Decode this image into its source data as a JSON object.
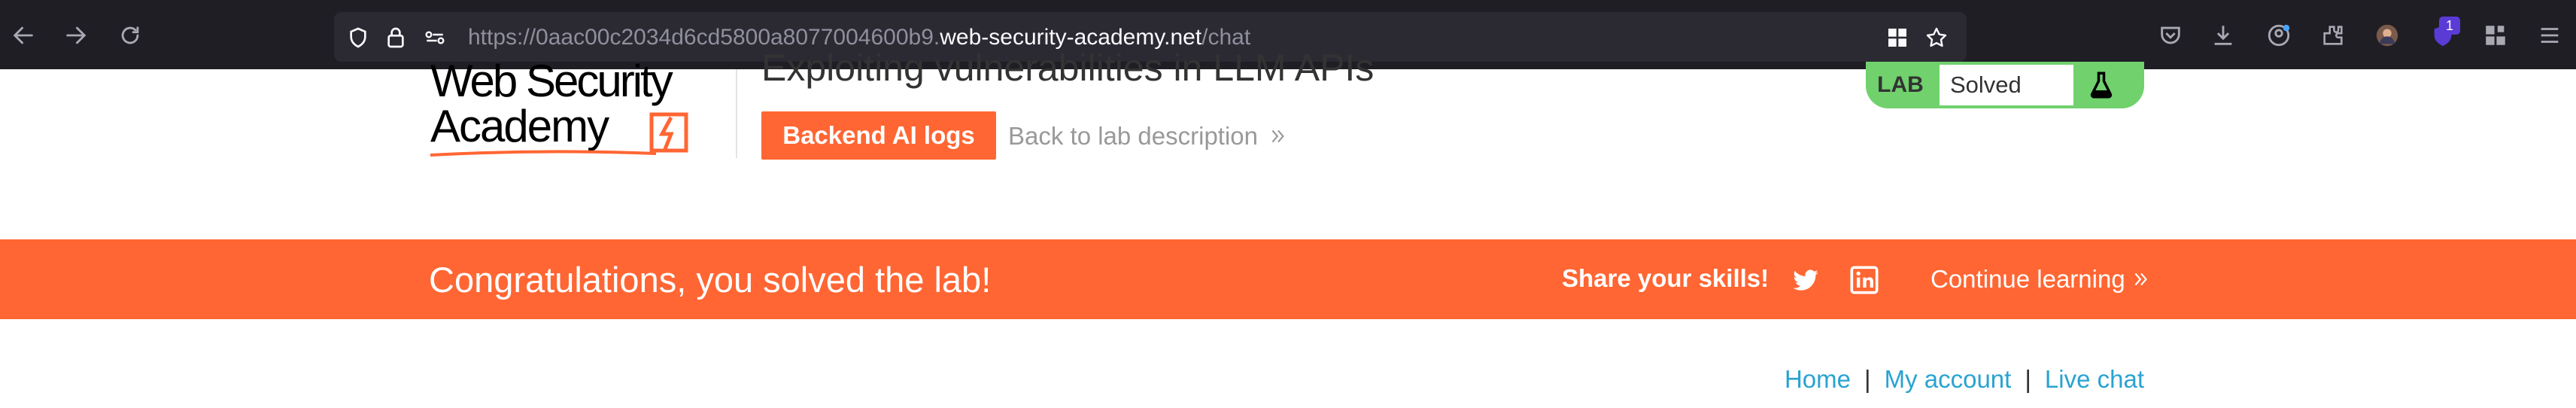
{
  "browser": {
    "url_prefix": "https://0aac00c2034d6cd5800a8077004600b9.",
    "url_host": "web-security-academy.net",
    "url_path": "/chat",
    "extension_badge": "1"
  },
  "header": {
    "logo_text_line1": "Web Security",
    "logo_text_line2": "Academy",
    "lab_title": "Exploiting vulnerabilities in LLM APIs",
    "backend_button": "Backend AI logs",
    "back_link": "Back to lab description",
    "lab_label": "LAB",
    "lab_status": "Solved"
  },
  "banner": {
    "message": "Congratulations, you solved the lab!",
    "share": "Share your skills!",
    "continue": "Continue learning"
  },
  "top_links": {
    "home": "Home",
    "account": "My account",
    "chat": "Live chat",
    "separator": "|"
  },
  "colors": {
    "accent": "#ff6633",
    "solved_green": "#70d16d",
    "link_blue": "#29a3d1",
    "browser_dark": "#1f1e25"
  }
}
